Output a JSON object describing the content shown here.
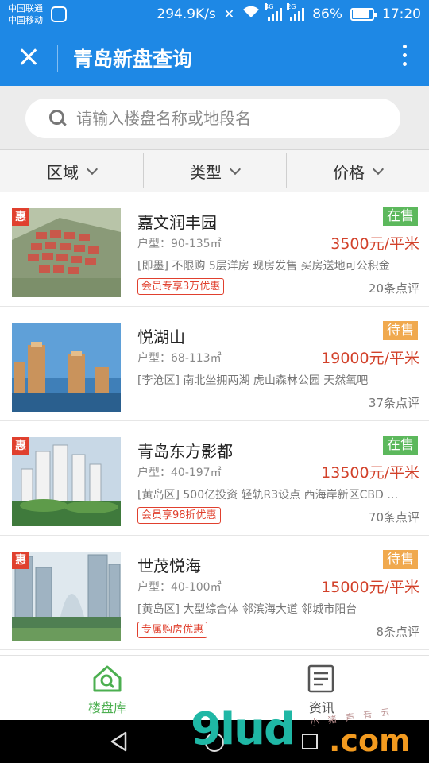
{
  "status_bar": {
    "carrier1": "中国联通",
    "carrier2": "中国移动",
    "speed": "294.9K/s",
    "net1": "4G",
    "net2": "2G",
    "battery": "86%",
    "battery_level": 0.86,
    "time": "17:20"
  },
  "app_bar": {
    "title": "青岛新盘查询",
    "close_icon": "close-icon",
    "more_icon": "more-vertical-icon"
  },
  "search": {
    "placeholder": "请输入楼盘名称或地段名",
    "value": ""
  },
  "filters": [
    {
      "label": "区域"
    },
    {
      "label": "类型"
    },
    {
      "label": "价格"
    }
  ],
  "listings": [
    {
      "name": "嘉文润丰园",
      "huxing": "户型：90-135㎡",
      "desc": "[即墨] 不限购 5层洋房 现房发售 买房送地可公积金",
      "promo": "会员专享3万优惠",
      "status": "在售",
      "price": "3500元/平米",
      "reviews": "20条点评",
      "hui": "惠",
      "status_color": "#5cb85c"
    },
    {
      "name": "悦湖山",
      "huxing": "户型：68-113㎡",
      "desc": "[李沧区] 南北坐拥两湖 虎山森林公园 天然氧吧",
      "promo": "",
      "status": "待售",
      "price": "19000元/平米",
      "reviews": "37条点评",
      "hui": "",
      "status_color": "#f0a94e"
    },
    {
      "name": "青岛东方影都",
      "huxing": "户型：40-197㎡",
      "desc": "[黄岛区] 500亿投资 轻轨R3设点 西海岸新区CBD 大…",
      "promo": "会员享98折优惠",
      "status": "在售",
      "price": "13500元/平米",
      "reviews": "70条点评",
      "hui": "惠",
      "status_color": "#5cb85c"
    },
    {
      "name": "世茂悦海",
      "huxing": "户型：40-100㎡",
      "desc": "[黄岛区] 大型综合体 邻滨海大道 邻城市阳台",
      "promo": "专属购房优惠",
      "status": "待售",
      "price": "15000元/平米",
      "reviews": "8条点评",
      "hui": "惠",
      "status_color": "#f0a94e"
    }
  ],
  "tabs": [
    {
      "label": "楼盘库",
      "icon": "house-search-icon"
    },
    {
      "label": "资讯",
      "icon": "news-icon"
    }
  ],
  "colors": {
    "primary": "#1e88e5",
    "accent_green": "#4caf50",
    "price_red": "#d2412a",
    "hui_red": "#e0402e"
  },
  "watermark": {
    "brand": "9lud",
    "domain": ".com",
    "small": "小 猪 声 音 云"
  }
}
